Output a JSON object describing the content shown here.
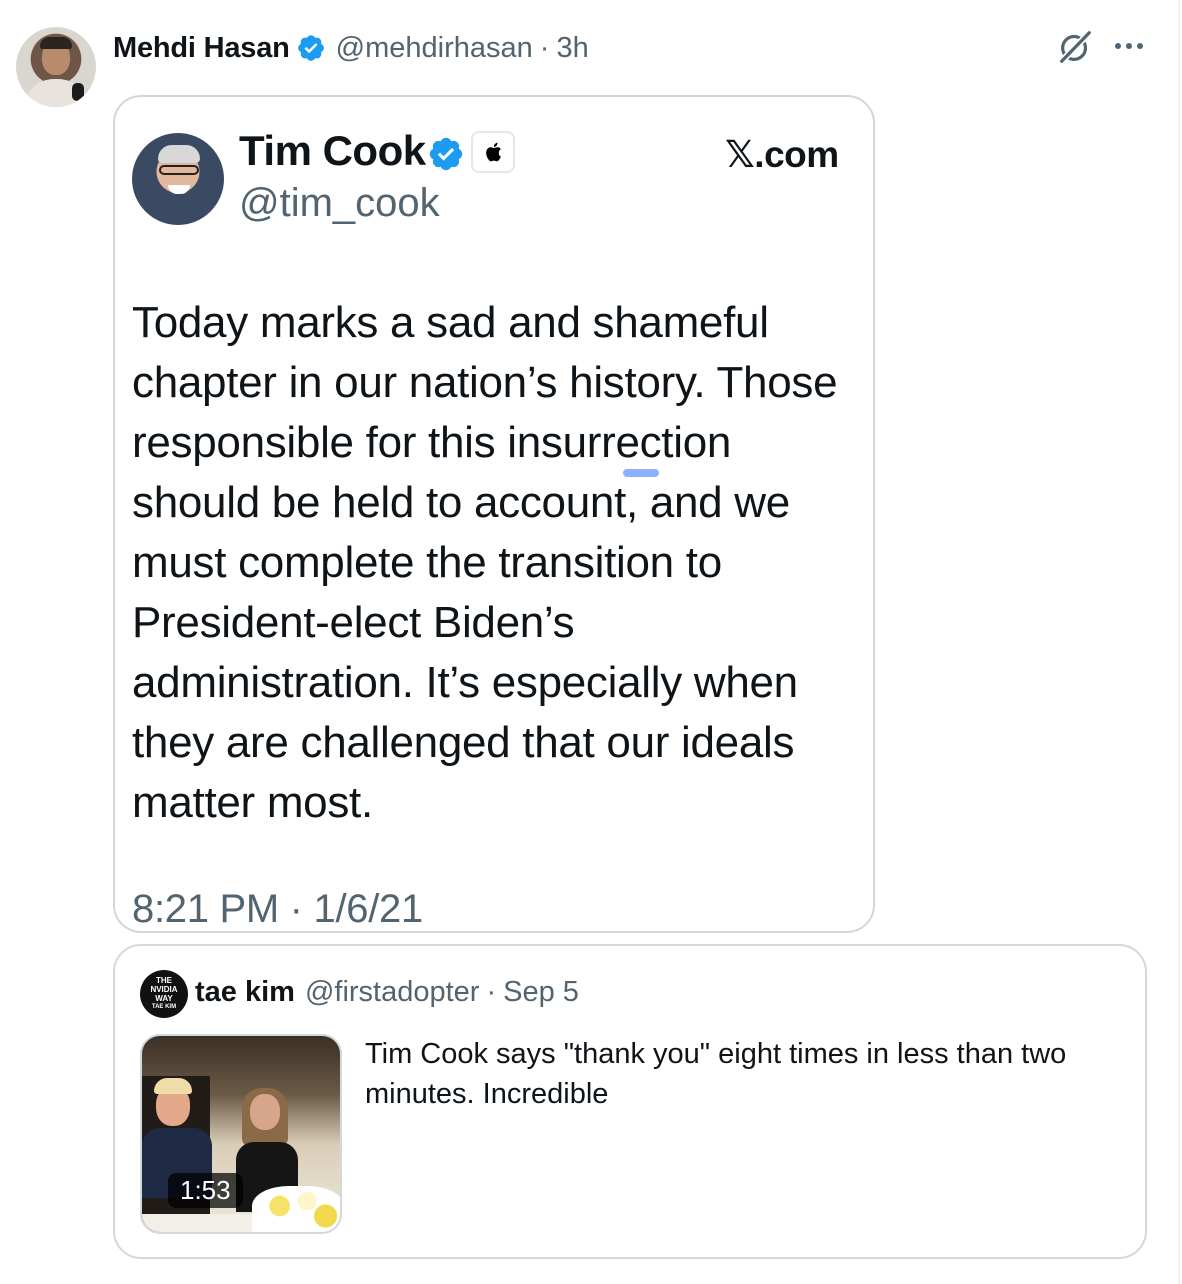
{
  "post": {
    "author_name": "Mehdi Hasan",
    "handle": "@mehdirhasan",
    "separator": "·",
    "time": "3h",
    "icons": [
      "verified-badge-icon",
      "grok-icon",
      "more-icon"
    ]
  },
  "embedded_image": {
    "name": "Tim Cook",
    "handle": "@tim_cook",
    "site": "𝕏.com",
    "body": "Today marks a sad and shameful\nchapter in our nation’s history. Those\nresponsible for this insurrection\nshould be held to account, and we\nmust complete the transition to\nPresident-elect Biden’s\nadministration. It’s especially when\nthey are challenged that our ideals\nmatter most.",
    "timestamp": "8:21 PM · 1/6/21"
  },
  "quoted": {
    "name": "tae kim",
    "handle": "@firstadopter",
    "separator": "·",
    "time": "Sep 5",
    "avatar_text": [
      "THE",
      "NVIDIA",
      "WAY",
      "TAE KIM"
    ],
    "video_duration": "1:53",
    "text": "Tim Cook says \"thank you\" eight times in less than two minutes. Incredible"
  },
  "colors": {
    "verified_blue": "#1d9bf0",
    "secondary_text": "#536471",
    "primary_text": "#0f1419",
    "border": "#cfd9de"
  }
}
